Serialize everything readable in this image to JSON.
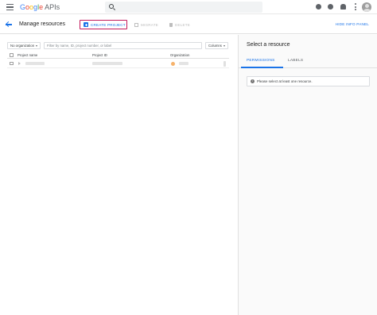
{
  "header": {
    "logo_parts": [
      "G",
      "o",
      "o",
      "g",
      "l",
      "e"
    ],
    "logo_suffix": "APIs"
  },
  "toolbar": {
    "page_title": "Manage resources",
    "create_label": "CREATE PROJECT",
    "migrate_label": "MIGRATE",
    "delete_label": "DELETE",
    "hide_panel_label": "HIDE INFO PANEL"
  },
  "filters": {
    "organization_value": "No organization",
    "filter_placeholder": "Filter by name, ID, project number, or label",
    "columns_label": "Columns"
  },
  "table": {
    "columns": [
      "Project name",
      "Project ID",
      "Organization"
    ],
    "rows": [
      {
        "name": "",
        "id": "",
        "organization": ""
      }
    ]
  },
  "info_panel": {
    "title": "Select a resource",
    "tabs": [
      {
        "label": "PERMISSIONS",
        "active": true
      },
      {
        "label": "LABELS",
        "active": false
      }
    ],
    "notice": "Please select at least one resource."
  },
  "colors": {
    "accent": "#1a73e8",
    "highlight_border": "#c2185b",
    "disabled": "#bdbdbd"
  },
  "icons": [
    "menu-icon",
    "search-icon",
    "support-icon",
    "help-icon",
    "notifications-icon",
    "more-vert-icon",
    "avatar",
    "back-arrow-icon",
    "add-box-icon",
    "migrate-icon",
    "trash-icon",
    "info-icon"
  ]
}
